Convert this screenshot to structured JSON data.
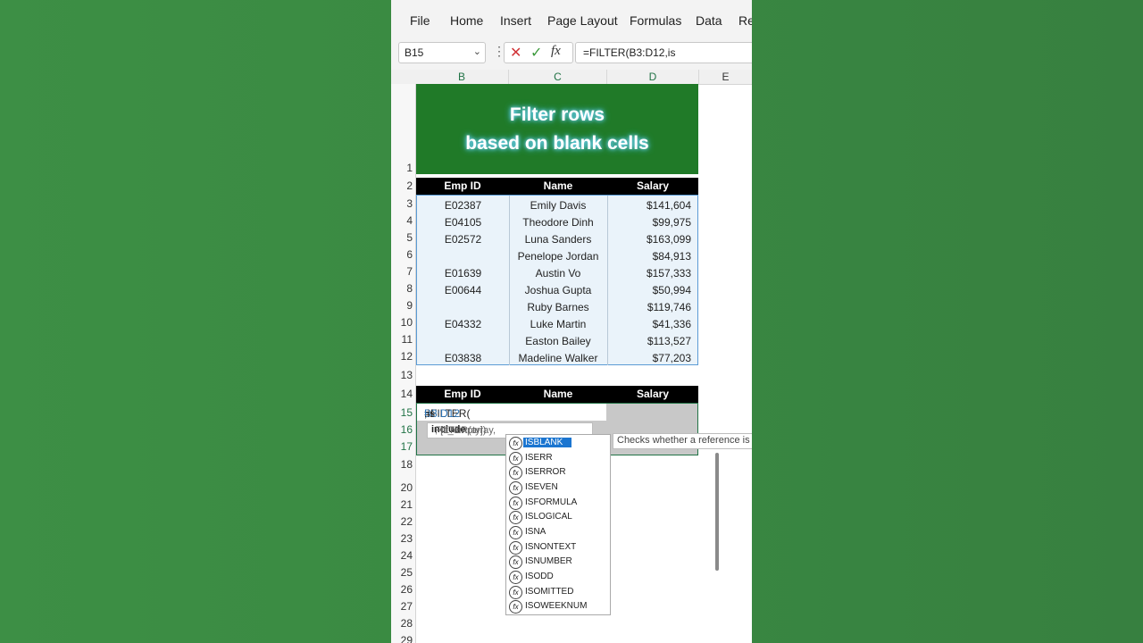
{
  "ribbon": {
    "tabs": [
      "File",
      "Home",
      "Insert",
      "Page Layout",
      "Formulas",
      "Data",
      "Re"
    ]
  },
  "formula_bar": {
    "name_box": "B15",
    "formula": "=FILTER(B3:D12,is",
    "fx_label": "fx"
  },
  "columns": [
    "B",
    "C",
    "D",
    "E"
  ],
  "rows": [
    "1",
    "2",
    "3",
    "4",
    "5",
    "6",
    "7",
    "8",
    "9",
    "10",
    "11",
    "12",
    "13",
    "14",
    "15",
    "16",
    "17",
    "18",
    "20",
    "21",
    "22",
    "23",
    "24",
    "25",
    "26",
    "27",
    "28",
    "29"
  ],
  "banner": {
    "line1": "Filter rows",
    "line2": "based on blank cells"
  },
  "table": {
    "headers": [
      "Emp ID",
      "Name",
      "Salary"
    ],
    "rows": [
      [
        "E02387",
        "Emily Davis",
        "$141,604"
      ],
      [
        "E04105",
        "Theodore Dinh",
        "$99,975"
      ],
      [
        "E02572",
        "Luna Sanders",
        "$163,099"
      ],
      [
        "",
        "Penelope Jordan",
        "$84,913"
      ],
      [
        "E01639",
        "Austin Vo",
        "$157,333"
      ],
      [
        "E00644",
        "Joshua Gupta",
        "$50,994"
      ],
      [
        "",
        "Ruby Barnes",
        "$119,746"
      ],
      [
        "E04332",
        "Luke Martin",
        "$41,336"
      ],
      [
        "",
        "Easton Bailey",
        "$113,527"
      ],
      [
        "E03838",
        "Madeline Walker",
        "$77,203"
      ]
    ]
  },
  "result_headers": [
    "Emp ID",
    "Name",
    "Salary"
  ],
  "editing": {
    "prefix": "=FILTER(",
    "range": "B3:D12",
    "suffix": ",is"
  },
  "tooltip": {
    "pre": "FILTER(array, ",
    "bold": "include",
    "post": ", [if_empty])"
  },
  "autocomplete": {
    "items": [
      "ISBLANK",
      "ISERR",
      "ISERROR",
      "ISEVEN",
      "ISFORMULA",
      "ISLOGICAL",
      "ISNA",
      "ISNONTEXT",
      "ISNUMBER",
      "ISODD",
      "ISOMITTED",
      "ISOWEEKNUM"
    ],
    "selected": "ISBLANK",
    "description": "Checks whether a reference is"
  },
  "colors": {
    "banner": "#207a28",
    "selection": "#1b75d0",
    "range_ref": "#2e75b6",
    "accent": "#217346"
  }
}
